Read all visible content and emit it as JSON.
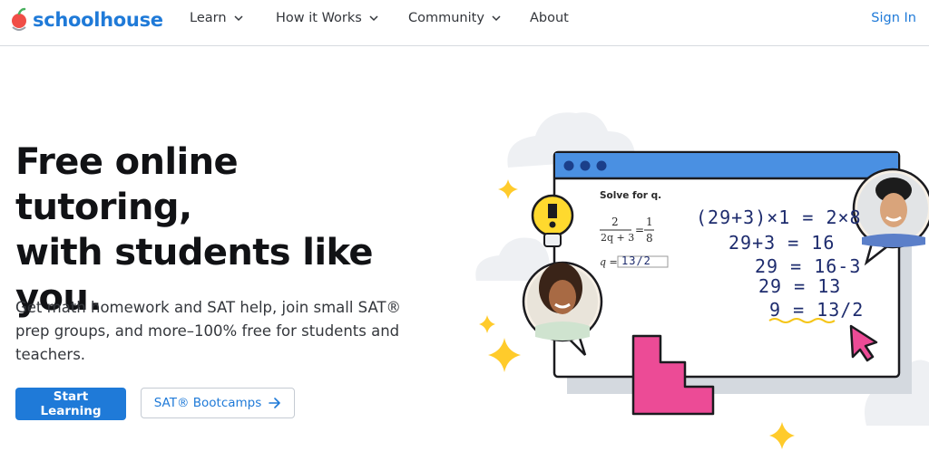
{
  "nav": {
    "brand": "schoolhouse",
    "items": [
      {
        "label": "Learn"
      },
      {
        "label": "How it Works"
      },
      {
        "label": "Community"
      },
      {
        "label": "About"
      }
    ],
    "signin": "Sign In"
  },
  "hero": {
    "headline_line1": "Free online tutoring,",
    "headline_line2": "with students like",
    "headline_line3": "you.",
    "subtext": "Get math homework and SAT help, join small SAT® prep groups, and more–100% free for students and teachers.",
    "cta_primary": "Start Learning",
    "cta_secondary": "SAT® Bootcamps"
  },
  "board": {
    "prompt": "Solve for q.",
    "frac1_num": "2",
    "frac1_den": "2q + 3",
    "equals": "=",
    "frac2_num": "1",
    "frac2_den": "8",
    "answer_label": "q =",
    "answer_value": "13/2",
    "steps": [
      "(29+3)×1 = 2×8",
      "29+3 = 16",
      "29 = 16-3",
      "29 = 13",
      "9 = 13/2"
    ]
  },
  "colors": {
    "brand": "#1f7ad8",
    "board_frame": "#4a90e2",
    "pink": "#ec4b96",
    "star": "#ffcb2b"
  }
}
